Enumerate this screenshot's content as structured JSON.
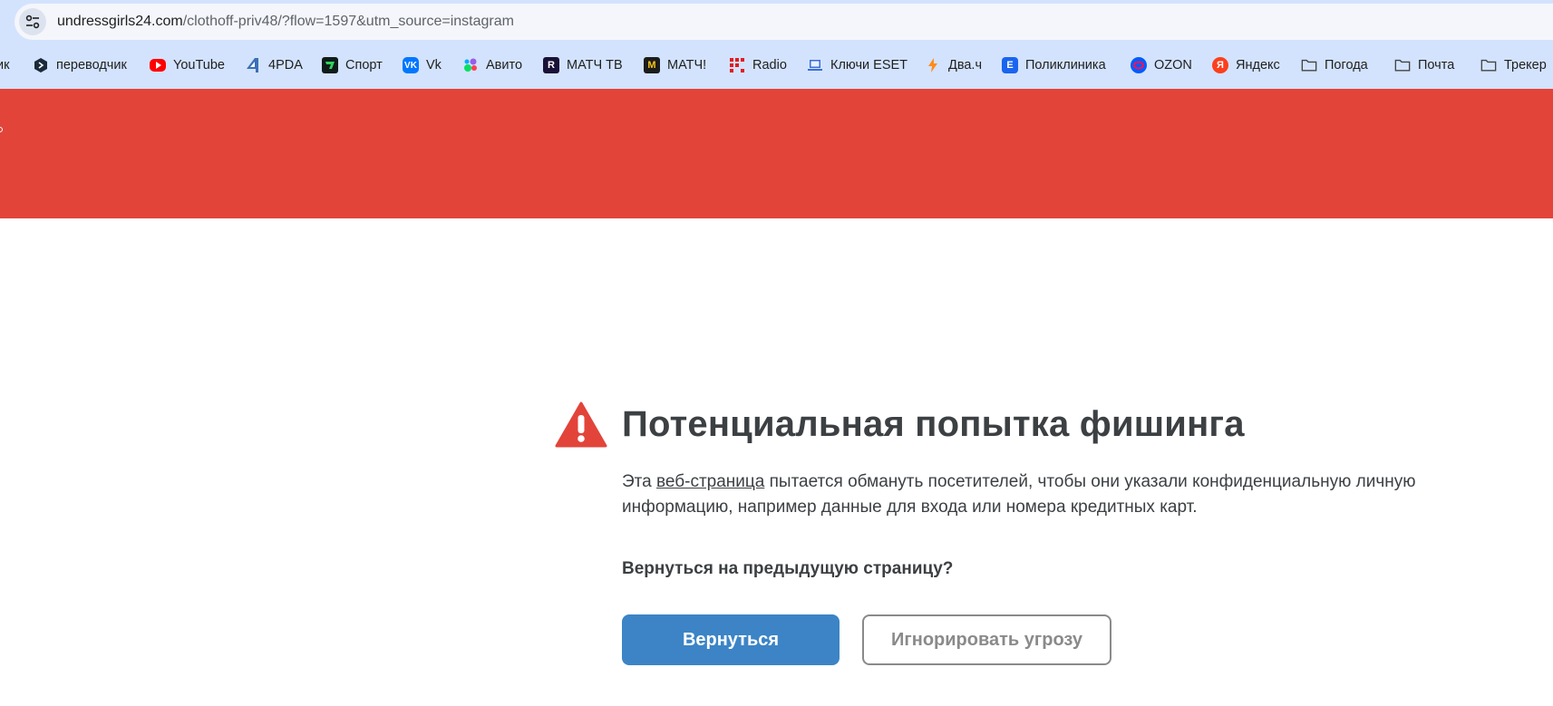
{
  "browser": {
    "url_host": "undressgirls24.com",
    "url_path": "/clothoff-priv48/?flow=1597&utm_source=instagram"
  },
  "bookmarks": [
    {
      "label": "ик",
      "icon": "partial-bookmark"
    },
    {
      "label": "переводчик",
      "icon": "translator-icon"
    },
    {
      "label": "YouTube",
      "icon": "youtube-icon"
    },
    {
      "label": "4PDA",
      "icon": "4pda-icon"
    },
    {
      "label": "Спорт",
      "icon": "sport-icon"
    },
    {
      "label": "Vk",
      "icon": "vk-icon"
    },
    {
      "label": "Авито",
      "icon": "avito-icon"
    },
    {
      "label": "МАТЧ ТВ",
      "icon": "match-tv-icon"
    },
    {
      "label": "МАТЧ!",
      "icon": "match-icon"
    },
    {
      "label": "Radio",
      "icon": "radio-icon"
    },
    {
      "label": "Ключи ESET",
      "icon": "laptop-icon"
    },
    {
      "label": "Два.ч",
      "icon": "lightning-icon"
    },
    {
      "label": "Поликлиника",
      "icon": "clinic-icon"
    },
    {
      "label": "OZON",
      "icon": "ozon-icon"
    },
    {
      "label": "Яндекс",
      "icon": "yandex-icon"
    },
    {
      "label": "Погода",
      "icon": "folder-icon"
    },
    {
      "label": "Почта",
      "icon": "folder-icon"
    },
    {
      "label": "Трекер",
      "icon": "folder-icon"
    }
  ],
  "warning": {
    "title": "Потенциальная попытка фишинга",
    "desc_before": "Эта ",
    "desc_link": "веб-страница",
    "desc_after": " пытается обмануть посетителей, чтобы они указали конфиденциальную личную информацию, например данные для входа или номера кредитных карт.",
    "question": "Вернуться на предыдущую страницу?",
    "back_label": "Вернуться",
    "ignore_label": "Игнорировать угрозу"
  },
  "colors": {
    "banner": "#e2443a",
    "primary_button": "#3c84c6",
    "text": "#3c4043",
    "warning_icon": "#e2443a"
  }
}
